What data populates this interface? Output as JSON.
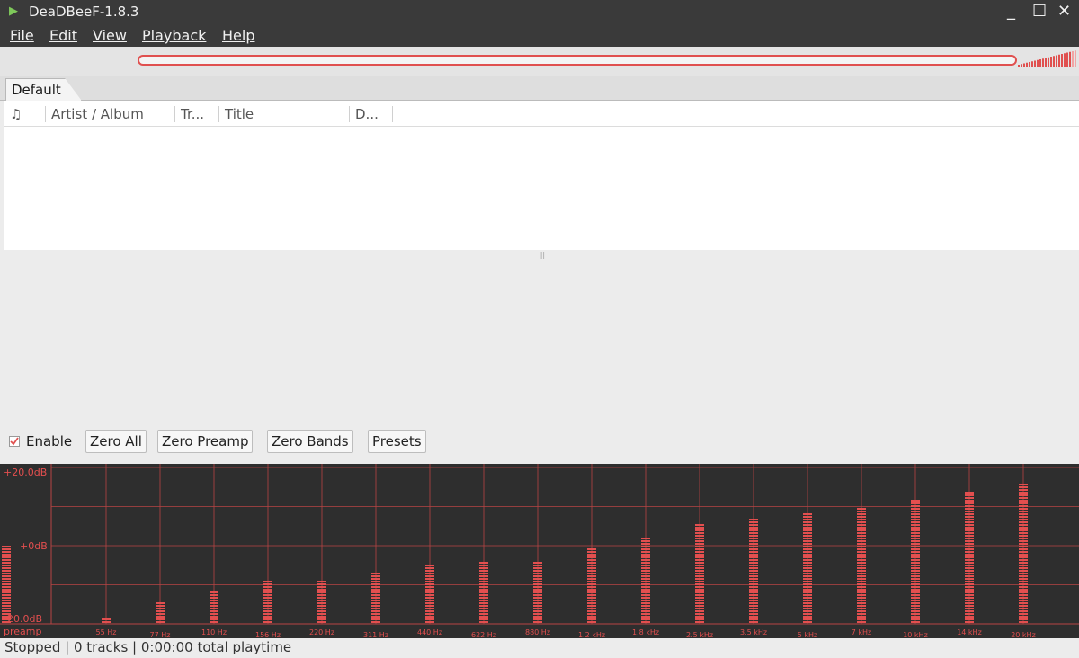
{
  "window": {
    "title": "DeaDBeeF-1.8.3"
  },
  "menu": [
    "File",
    "Edit",
    "View",
    "Playback",
    "Help"
  ],
  "toolbar": {
    "icons": [
      "stop-icon",
      "play-icon",
      "pause-icon",
      "prev-icon",
      "next-icon"
    ],
    "accent": "#e0504f",
    "play_color": "#3aaa3a"
  },
  "tabs": [
    "Default"
  ],
  "playlist": {
    "columns": [
      "♫",
      "Artist / Album",
      "Tr...",
      "Title",
      "D..."
    ],
    "rows": []
  },
  "eq": {
    "enable_label": "Enable",
    "enabled": true,
    "buttons": [
      "Zero All",
      "Zero Preamp",
      "Zero Bands",
      "Presets"
    ],
    "db_labels": [
      "+20.0dB",
      "+0dB",
      "-20.0dB"
    ],
    "preamp_label": "preamp",
    "preamp_db": 0,
    "bands": [
      {
        "label": "55 Hz",
        "db": -18.4
      },
      {
        "label": "77 Hz",
        "db": -14.0
      },
      {
        "label": "110 Hz",
        "db": -11.1
      },
      {
        "label": "156 Hz",
        "db": -8.9
      },
      {
        "label": "220 Hz",
        "db": -8.9
      },
      {
        "label": "311 Hz",
        "db": -6.7
      },
      {
        "label": "440 Hz",
        "db": -4.5
      },
      {
        "label": "622 Hz",
        "db": -3.8
      },
      {
        "label": "880 Hz",
        "db": -3.8
      },
      {
        "label": "1.2 kHz",
        "db": -0.2
      },
      {
        "label": "1.8 kHz",
        "db": 2.7
      },
      {
        "label": "2.5 kHz",
        "db": 5.6
      },
      {
        "label": "3.5 kHz",
        "db": 7.1
      },
      {
        "label": "5 kHz",
        "db": 8.6
      },
      {
        "label": "7 kHz",
        "db": 10.1
      },
      {
        "label": "10 kHz",
        "db": 12.4
      },
      {
        "label": "14 kHz",
        "db": 13.8
      },
      {
        "label": "20 kHz",
        "db": 16.0
      }
    ],
    "bar_color": "#e34f4f",
    "grid_color": "#b84444"
  },
  "status": {
    "text": "Stopped | 0 tracks | 0:00:00 total playtime"
  }
}
